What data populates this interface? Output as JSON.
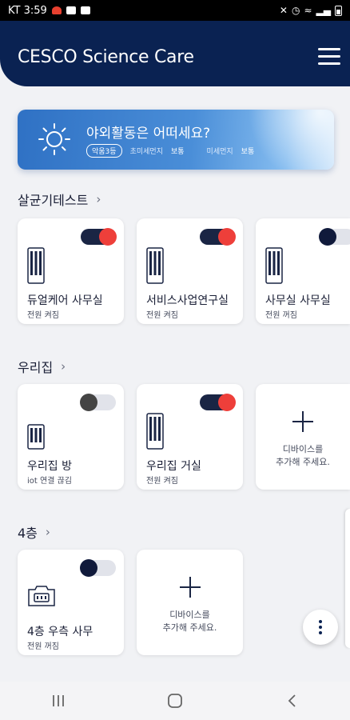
{
  "status_bar": {
    "carrier_time": "KT 3:59"
  },
  "header": {
    "title": "CESCO Science Care"
  },
  "weather": {
    "headline": "야외활동은 어떠세요?",
    "badge": "악움3등",
    "items": [
      {
        "label": "초미세먼지",
        "value": "보통"
      },
      {
        "label": "미세먼지",
        "value": "보통"
      }
    ]
  },
  "sections": [
    {
      "title": "살균기테스트",
      "cards": [
        {
          "name": "듀얼케어 사무실",
          "status": "전원 켜짐",
          "toggle": "on"
        },
        {
          "name": "서비스사업연구실",
          "status": "전원 켜짐",
          "toggle": "on"
        },
        {
          "name": "사무실 사무실",
          "status": "전원 꺼짐",
          "toggle": "off"
        }
      ]
    },
    {
      "title": "우리집",
      "cards": [
        {
          "name": "우리집 방",
          "status": "iot 연결 끊김",
          "toggle": "disabled"
        },
        {
          "name": "우리집 거실",
          "status": "전원 켜짐",
          "toggle": "on"
        }
      ],
      "add_card": {
        "line1": "디바이스를",
        "line2": "추가해 주세요."
      }
    },
    {
      "title": "4층",
      "cards": [
        {
          "name": "4층 우측 사무",
          "status": "전원 꺼짐",
          "toggle": "off"
        }
      ],
      "add_card": {
        "line1": "디바이스를",
        "line2": "추가해 주세요."
      }
    }
  ],
  "colors": {
    "brand_navy": "#0a2252",
    "toggle_on": "#ee3f3a",
    "background": "#f1f2f5"
  }
}
